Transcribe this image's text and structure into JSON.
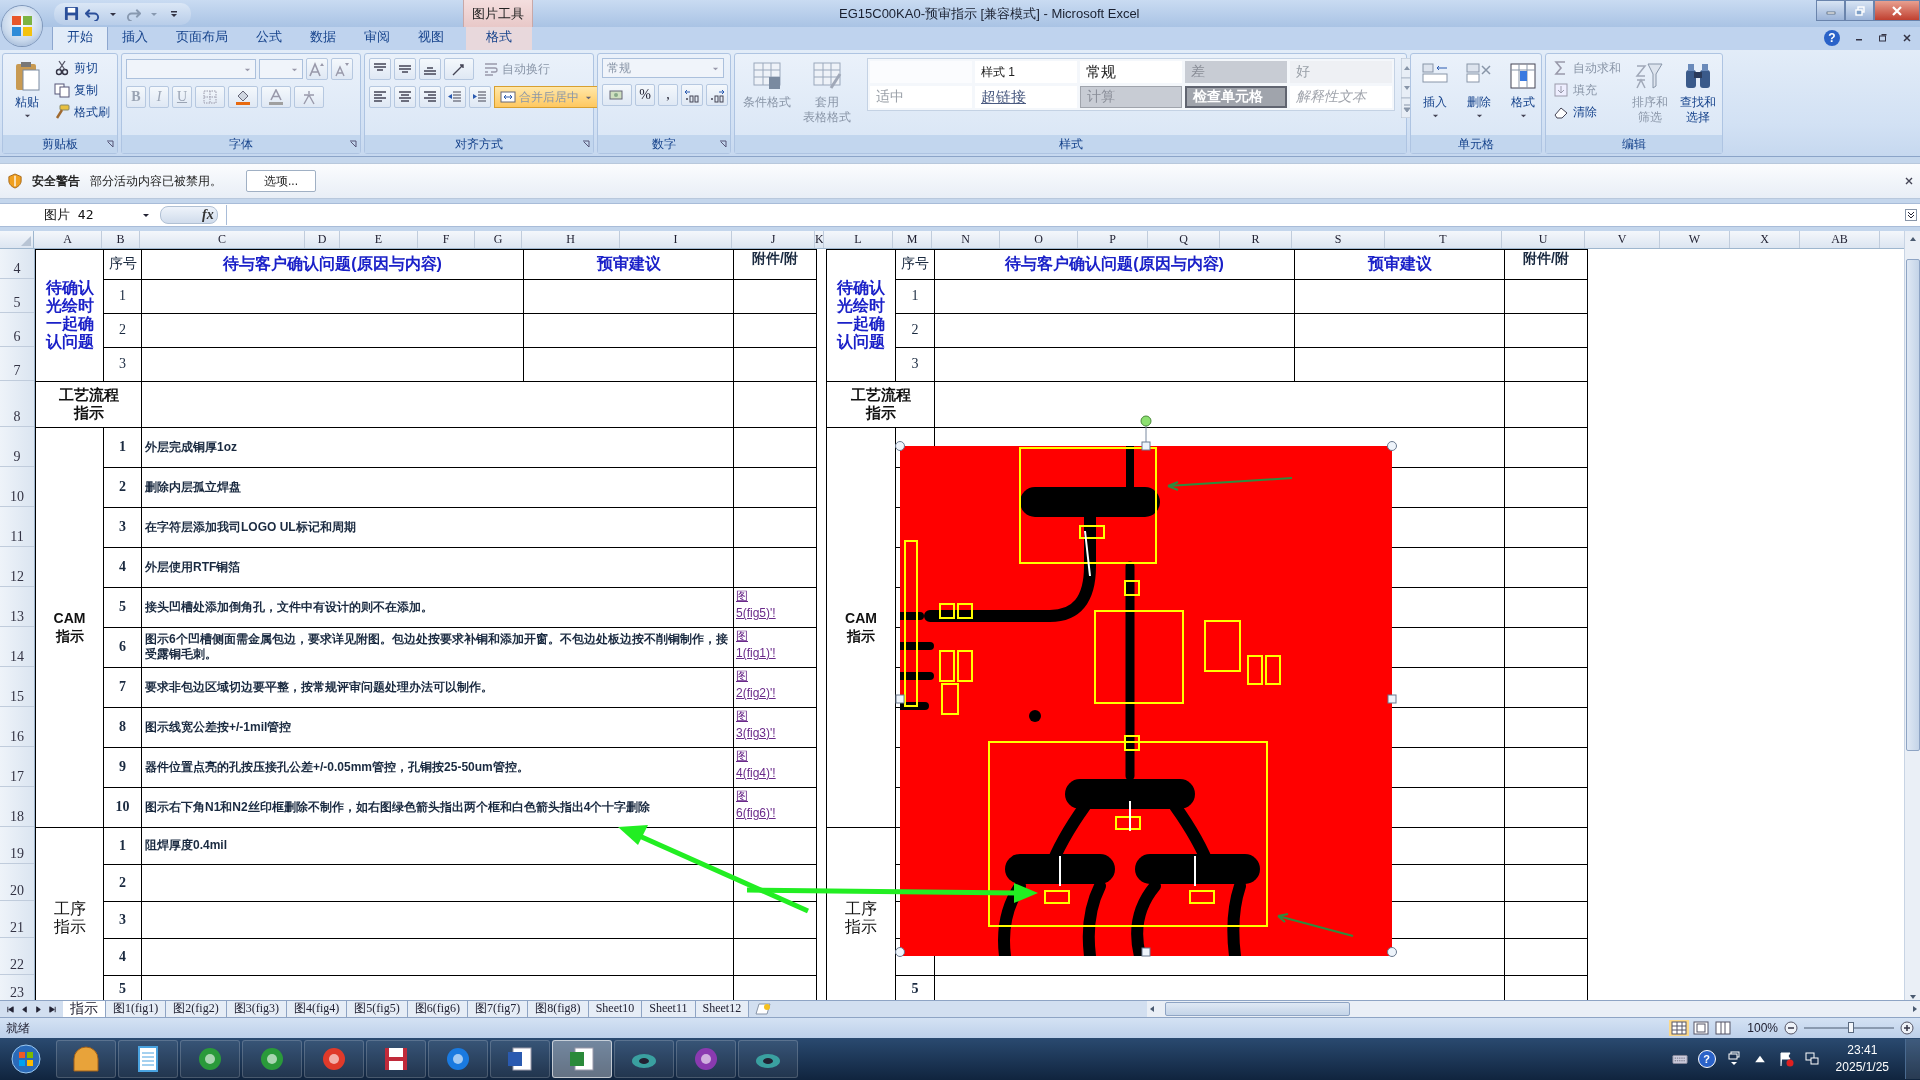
{
  "window": {
    "title": "EG15C00KA0-预审指示  [兼容模式] - Microsoft Excel",
    "context_tool": "图片工具"
  },
  "ribbon_tabs": [
    {
      "label": "开始",
      "selected": true,
      "kind": "main"
    },
    {
      "label": "插入",
      "selected": false,
      "kind": "main"
    },
    {
      "label": "页面布局",
      "selected": false,
      "kind": "main"
    },
    {
      "label": "公式",
      "selected": false,
      "kind": "main"
    },
    {
      "label": "数据",
      "selected": false,
      "kind": "main"
    },
    {
      "label": "审阅",
      "selected": false,
      "kind": "main"
    },
    {
      "label": "视图",
      "selected": false,
      "kind": "main"
    },
    {
      "label": "格式",
      "selected": false,
      "kind": "contextual"
    }
  ],
  "help": "?",
  "ribbon": {
    "clipboard": {
      "label": "剪贴板",
      "paste": {
        "text": "粘贴",
        "disabled": false
      },
      "small": [
        {
          "text": "剪切",
          "disabled": false
        },
        {
          "text": "复制",
          "disabled": false
        },
        {
          "text": "格式刷",
          "disabled": false
        }
      ]
    },
    "font": {
      "label": "字体",
      "tools": [
        {
          "text": "B",
          "disabled": true
        },
        {
          "text": "I",
          "disabled": true
        },
        {
          "text": "U",
          "disabled": true
        }
      ]
    },
    "alignment": {
      "label": "对齐方式",
      "wrap": {
        "text": "自动换行",
        "disabled": true
      },
      "merge": {
        "text": "合并后居中",
        "pressed": true
      }
    },
    "number": {
      "label": "数字",
      "format": {
        "text": "常规",
        "disabled": true
      },
      "tools": [
        {
          "text": "%",
          "disabled": false
        },
        {
          "text": ",",
          "disabled": false
        }
      ]
    },
    "styles": {
      "label": "样式",
      "large": [
        {
          "text": [
            "条件格式"
          ],
          "disabled": true
        },
        {
          "text": [
            "套用",
            "表格格式"
          ],
          "disabled": true
        }
      ],
      "gallery": [
        [
          {
            "text": "样式 1",
            "kind": "plain"
          },
          {
            "text": "常规",
            "kind": "normal"
          },
          {
            "text": "差",
            "kind": "bad"
          },
          {
            "text": "好",
            "kind": "good"
          }
        ],
        [
          {
            "text": "适中",
            "kind": "neutral"
          },
          {
            "text": "超链接",
            "kind": "link"
          },
          {
            "text": "计算",
            "kind": "calc"
          },
          {
            "text": "检查单元格",
            "kind": "check"
          },
          {
            "text": "解释性文本",
            "kind": "note"
          }
        ]
      ]
    },
    "cells": {
      "label": "单元格",
      "buttons": [
        {
          "text": "插入",
          "disabled": false
        },
        {
          "text": "删除",
          "disabled": false
        },
        {
          "text": "格式",
          "disabled": false
        }
      ]
    },
    "editing": {
      "label": "编辑",
      "small": [
        {
          "text": "自动求和",
          "disabled": true
        },
        {
          "text": "填充",
          "disabled": true
        },
        {
          "text": "清除",
          "disabled": false
        }
      ],
      "large": [
        {
          "text": [
            "排序和",
            "筛选"
          ],
          "disabled": true
        },
        {
          "text": [
            "查找和",
            "选择"
          ],
          "disabled": false
        }
      ]
    }
  },
  "security_bar": {
    "title": "安全警告",
    "message": "部分活动内容已被禁用。",
    "button": "选项..."
  },
  "formula_bar": {
    "name_box": "图片 42",
    "fx": "fx"
  },
  "columns": [
    "A",
    "B",
    "C",
    "D",
    "E",
    "F",
    "G",
    "H",
    "I",
    "J",
    "K",
    "L",
    "M",
    "N",
    "O",
    "P",
    "Q",
    "R",
    "S",
    "T",
    "U",
    "V",
    "W",
    "X",
    "AB"
  ],
  "row_numbers": [
    "4",
    "5",
    "6",
    "7",
    "8",
    "9",
    "10",
    "11",
    "12",
    "13",
    "14",
    "15",
    "16",
    "17",
    "18",
    "19",
    "20",
    "21",
    "22",
    "23"
  ],
  "left_table": {
    "header": {
      "seq": "序号",
      "issue": "待与客户确认问题(原因与内容)",
      "suggestion": "预审建议",
      "attachment": "附件/附"
    },
    "pending_label": "待确认光绘时一起确认问题",
    "pending_rows": [
      "1",
      "2",
      "3"
    ],
    "process_label": [
      "工艺流程",
      "指示"
    ],
    "cam_label": [
      "CAM",
      "指示"
    ],
    "cam_items": [
      {
        "no": "1",
        "text": "外层完成铜厚1oz"
      },
      {
        "no": "2",
        "text": "删除内层孤立焊盘"
      },
      {
        "no": "3",
        "text": "在字符层添加我司LOGO  UL标记和周期"
      },
      {
        "no": "4",
        "text": "外层使用RTF铜箔"
      },
      {
        "no": "5",
        "text": "接头凹槽处添加倒角孔，文件中有设计的则不在添加。",
        "link": [
          "图",
          "5(fig5)'!"
        ]
      },
      {
        "no": "6",
        "text": "图示6个凹槽侧面需金属包边，要求详见附图。包边处按要求补铜和添加开窗。不包边处板边按不削铜制作，接受露铜毛刺。",
        "link": [
          "图",
          "1(fig1)'!"
        ]
      },
      {
        "no": "7",
        "text": "要求非包边区域切边要平整，按常规评审问题处理办法可以制作。",
        "link": [
          "图",
          "2(fig2)'!"
        ]
      },
      {
        "no": "8",
        "text": "图示线宽公差按+/-1mil管控",
        "link": [
          "图",
          "3(fig3)'!"
        ]
      },
      {
        "no": "9",
        "text": "器件位置点亮的孔按压接孔公差+/-0.05mm管控，孔铜按25-50um管控。",
        "link": [
          "图",
          "4(fig4)'!"
        ]
      },
      {
        "no": "10",
        "text": "图示右下角N1和N2丝印框删除不制作，如右图绿色箭头指出两个框和白色箭头指出4个十字删除",
        "link": [
          "图",
          "6(fig6)'!"
        ]
      }
    ],
    "step_label": [
      "工序",
      "指示"
    ],
    "process_items": [
      {
        "no": "1",
        "text": "阻焊厚度0.4mil"
      },
      {
        "no": "2"
      },
      {
        "no": "3"
      },
      {
        "no": "4"
      },
      {
        "no": "5"
      }
    ]
  },
  "right_table": {
    "header": {
      "seq": "序号",
      "issue": "待与客户确认问题(原因与内容)",
      "suggestion": "预审建议",
      "attachment": "附件/附"
    },
    "pending_label": "待确认光绘时一起确认问题",
    "pending_rows": [
      "1",
      "2",
      "3"
    ],
    "process_label": [
      "工艺流程",
      "指示"
    ],
    "cam_label": [
      "CAM",
      "指示"
    ],
    "step_label": [
      "工序",
      "指示"
    ],
    "process_items": [
      {
        "no": "5"
      }
    ]
  },
  "sheet_tabs": [
    {
      "label": "指示",
      "selected": true
    },
    {
      "label": "图1(fig1)",
      "selected": false
    },
    {
      "label": "图2(fig2)",
      "selected": false
    },
    {
      "label": "图3(fig3)",
      "selected": false
    },
    {
      "label": "图4(fig4)",
      "selected": false
    },
    {
      "label": "图5(fig5)",
      "selected": false
    },
    {
      "label": "图6(fig6)",
      "selected": false
    },
    {
      "label": "图7(fig7)",
      "selected": false
    },
    {
      "label": "图8(fig8)",
      "selected": false
    },
    {
      "label": "Sheet10",
      "selected": false
    },
    {
      "label": "Sheet11",
      "selected": false
    },
    {
      "label": "Sheet12",
      "selected": false
    }
  ],
  "status_bar": {
    "status": "就绪",
    "zoom": "100%",
    "zoom_slider": {
      "level": 0.52
    }
  },
  "taskbar": {
    "apps": [
      {
        "selected": false
      },
      {
        "selected": false
      },
      {
        "selected": false
      },
      {
        "selected": false
      },
      {
        "selected": false
      },
      {
        "selected": false
      },
      {
        "selected": false
      },
      {
        "selected": false
      },
      {
        "selected": true
      },
      {
        "selected": false
      },
      {
        "selected": false
      },
      {
        "selected": false
      }
    ],
    "help": "?",
    "time": "23:41",
    "date": "2025/1/25"
  }
}
